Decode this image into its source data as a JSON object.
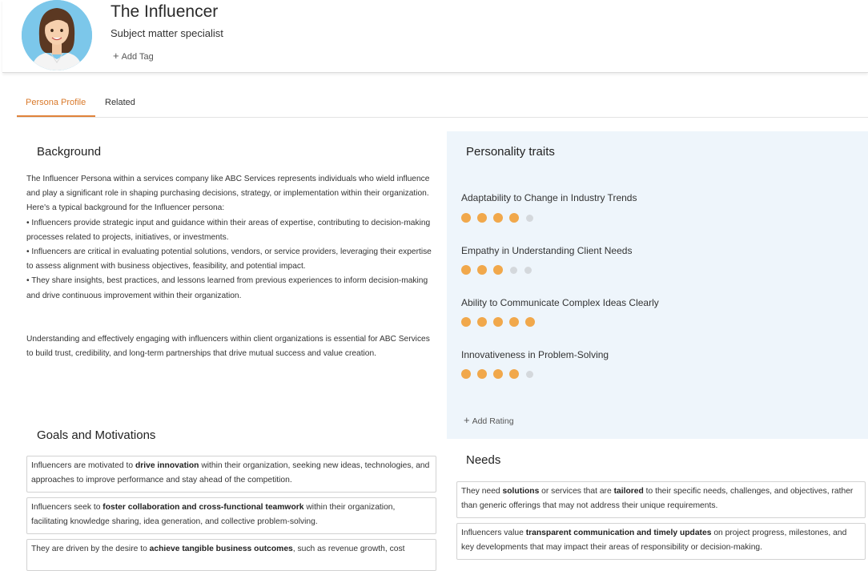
{
  "header": {
    "title": "The Influencer",
    "subtitle": "Subject matter specialist",
    "add_tag_label": "Add Tag"
  },
  "tabs": [
    {
      "label": "Persona Profile",
      "active": true
    },
    {
      "label": "Related",
      "active": false
    }
  ],
  "background": {
    "title": "Background",
    "paragraphs": [
      "The Influencer Persona within a services company like ABC Services represents individuals who wield influence and play a significant role in shaping purchasing decisions, strategy, or implementation within their organization. Here's a typical background for the Influencer persona:",
      "• Influencers provide strategic input and guidance within their areas of expertise, contributing to decision-making processes related to projects, initiatives, or investments.",
      "• Influencers are critical in evaluating potential solutions, vendors, or service providers, leveraging their expertise to assess alignment with business objectives, feasibility, and potential impact.",
      "• They share insights, best practices, and lessons learned from previous experiences to inform decision-making and drive continuous improvement within their organization."
    ],
    "closing": "Understanding and effectively engaging with influencers within client organizations is essential for ABC Services to build trust, credibility, and long-term partnerships that drive mutual success and value creation."
  },
  "personality": {
    "title": "Personality traits",
    "traits": [
      {
        "label": "Adaptability to Change in Industry Trends",
        "rating": 4,
        "max": 5
      },
      {
        "label": "Empathy in Understanding Client Needs",
        "rating": 3,
        "max": 5
      },
      {
        "label": "Ability to Communicate Complex Ideas Clearly",
        "rating": 5,
        "max": 5
      },
      {
        "label": "Innovativeness in Problem-Solving",
        "rating": 4,
        "max": 5
      }
    ],
    "add_rating_label": "Add Rating"
  },
  "goals": {
    "title": "Goals and Motivations",
    "items": [
      {
        "pre": "Influencers are motivated to ",
        "bold": "drive innovation",
        "post": " within their organization, seeking new ideas, technologies, and approaches to improve performance and stay ahead of the competition."
      },
      {
        "pre": "Influencers seek to ",
        "bold": "foster collaboration and cross-functional teamwork",
        "post": " within their organization, facilitating knowledge sharing, idea generation, and collective problem-solving."
      },
      {
        "pre": "They are driven by the desire to ",
        "bold": "achieve tangible business outcomes",
        "post": ", such as revenue growth, cost"
      }
    ]
  },
  "needs": {
    "title": "Needs",
    "items": [
      {
        "parts": [
          {
            "t": "They need "
          },
          {
            "b": "solutions"
          },
          {
            "t": " or services that are "
          },
          {
            "b": "tailored"
          },
          {
            "t": " to their specific needs, challenges, and objectives, rather than generic offerings that may not address their unique requirements."
          }
        ]
      },
      {
        "parts": [
          {
            "t": "Influencers value "
          },
          {
            "b": "transparent communication and timely updates"
          },
          {
            "t": " on project progress, milestones, and key developments that may impact their areas of responsibility or decision-making."
          }
        ]
      }
    ]
  },
  "colors": {
    "accent": "#e0823a",
    "rating_filled": "#f1a84b",
    "rating_empty": "#d4d8dc",
    "traits_panel_bg": "#eef5fb"
  }
}
